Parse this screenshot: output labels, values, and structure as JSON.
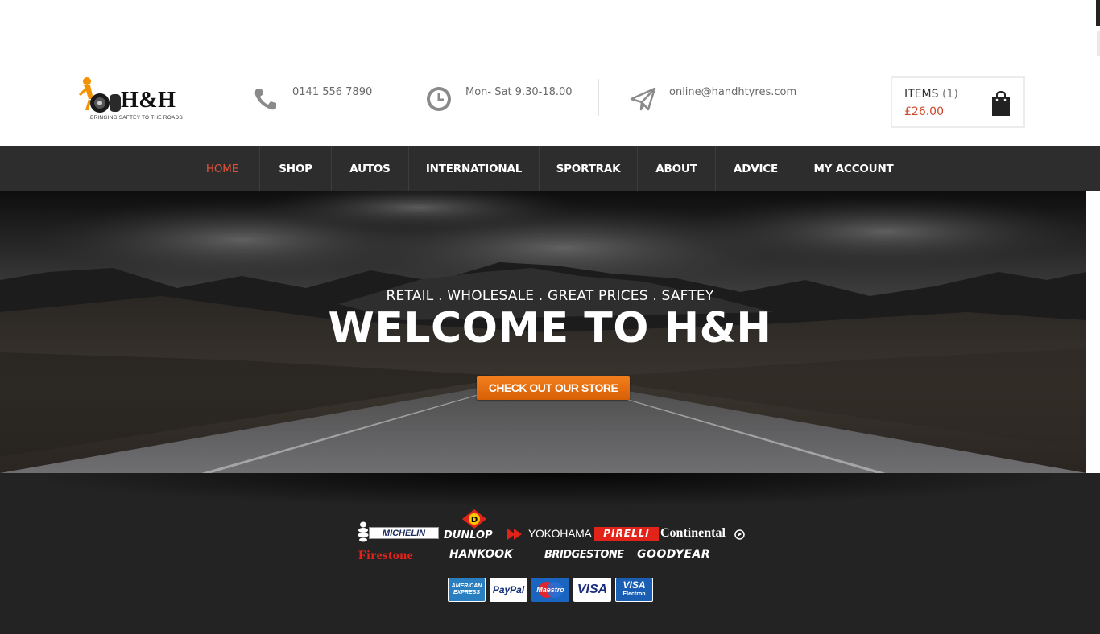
{
  "brand": {
    "logo_text": "H&H",
    "tagline": "BRINGING SAFTEY TO THE ROADS"
  },
  "contacts": [
    {
      "icon": "phone-icon",
      "text": "0141 556 7890"
    },
    {
      "icon": "clock-icon",
      "text": "Mon- Sat 9.30-18.00"
    },
    {
      "icon": "paper-plane-icon",
      "text": "online@handhtyres.com"
    }
  ],
  "cart": {
    "label": "ITEMS",
    "count": "(1)",
    "total": "£26.00",
    "icon": "shopping-bag-icon"
  },
  "nav": {
    "items": [
      {
        "label": "HOME",
        "active": true
      },
      {
        "label": "SHOP"
      },
      {
        "label": "AUTOS"
      },
      {
        "label": "INTERNATIONAL"
      },
      {
        "label": "SPORTRAK"
      },
      {
        "label": "ABOUT"
      },
      {
        "label": "ADVICE"
      },
      {
        "label": "MY ACCOUNT"
      }
    ]
  },
  "hero": {
    "subtitle": "RETAIL . WHOLESALE . GREAT PRICES . SAFTEY",
    "title": "WELCOME TO H&H",
    "cta": "CHECK OUT OUR STORE"
  },
  "footer": {
    "tyre_brands": [
      "MICHELIN",
      "DUNLOP",
      "YOKOHAMA",
      "PIRELLI",
      "Continental",
      "Firestone",
      "Hankook",
      "BRIDGESTONE",
      "GOODYEAR"
    ],
    "payment_methods": [
      "AMERICAN EXPRESS",
      "PayPal",
      "Maestro",
      "VISA",
      "VISA",
      "Electron"
    ]
  },
  "colors": {
    "accent": "#e0533a",
    "nav_bg": "#2d2d2d",
    "footer_bg": "#232323",
    "cta": "#e8700f"
  }
}
